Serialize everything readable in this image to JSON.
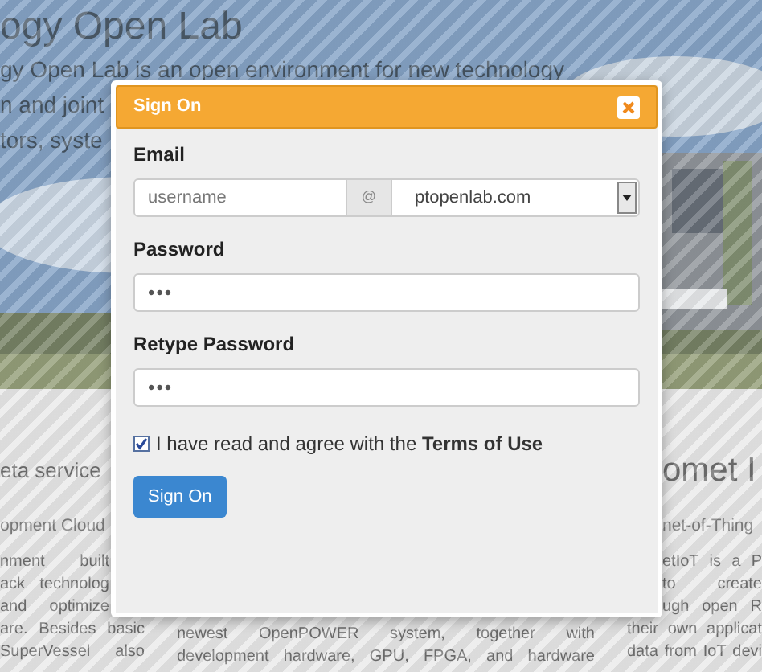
{
  "page": {
    "hero": {
      "title": "ogy Open Lab",
      "lines": [
        "gy Open Lab is an open environment for new technology",
        "n and joint",
        "tors, syste"
      ]
    },
    "columns": [
      {
        "title": "eta service",
        "subtitle": "opment Cloud",
        "lines": [
          "nment built",
          "ack technolog",
          "and optimize",
          "are. Besides basic",
          "SuperVessel also"
        ]
      },
      {
        "lines": [
          "newest OpenPOWER system, together with",
          "development hardware, GPU, FPGA, and hardware"
        ]
      },
      {
        "title": "omet I",
        "subtitle": "net-of-Thing",
        "lines": [
          "etIoT is a P",
          "to create",
          "ugh open R",
          "their own applicat",
          "data from IoT devi"
        ]
      }
    ]
  },
  "dialog": {
    "title": "Sign On",
    "email": {
      "label": "Email",
      "placeholder": "username",
      "at": "@",
      "domain": "ptopenlab.com"
    },
    "password": {
      "label": "Password",
      "value": "•••"
    },
    "retype": {
      "label": "Retype Password",
      "value": "•••"
    },
    "agree": {
      "text": "I have read and agree with the **Terms of Use**",
      "checked": true
    },
    "submit": "Sign On"
  }
}
